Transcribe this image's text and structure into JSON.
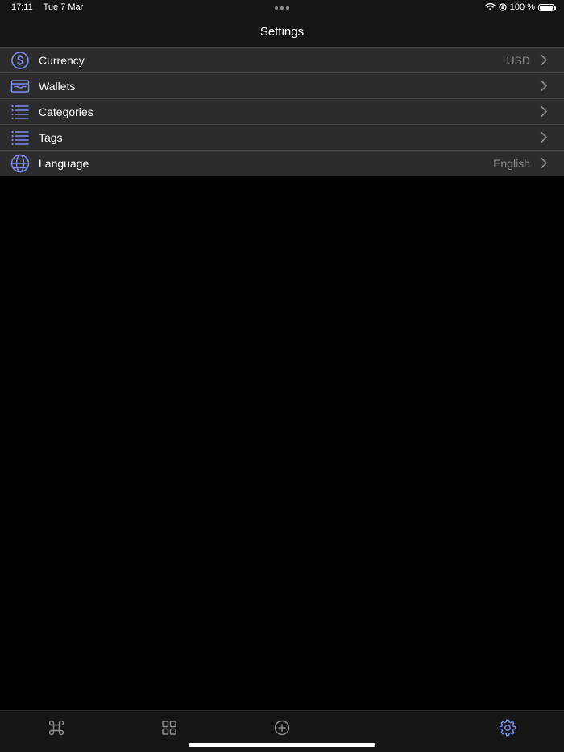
{
  "status_bar": {
    "time": "17:11",
    "date": "Tue 7 Mar",
    "battery_text": "100 %",
    "battery_level": 1.0,
    "icons": [
      "wifi-icon",
      "orientation-lock-icon",
      "battery-icon"
    ]
  },
  "nav": {
    "title": "Settings"
  },
  "settings": {
    "items": [
      {
        "label": "Currency",
        "value": "USD",
        "icon": "dollar-circle-icon"
      },
      {
        "label": "Wallets",
        "value": "",
        "icon": "wallet-card-icon"
      },
      {
        "label": "Categories",
        "value": "",
        "icon": "list-icon"
      },
      {
        "label": "Tags",
        "value": "",
        "icon": "list-icon"
      },
      {
        "label": "Language",
        "value": "English",
        "icon": "globe-icon"
      }
    ]
  },
  "tabbar": {
    "tabs": [
      {
        "icon": "command-icon",
        "selected": false
      },
      {
        "icon": "grid-icon",
        "selected": false
      },
      {
        "icon": "add-circle-icon",
        "selected": false
      },
      {
        "icon": "gear-icon",
        "selected": true
      }
    ]
  },
  "colors": {
    "accent": "#7b8cf0",
    "row_background": "#2c2c2e",
    "secondary_text": "#8a8a8e",
    "tab_inactive": "#8e8e93",
    "background": "#000000"
  }
}
